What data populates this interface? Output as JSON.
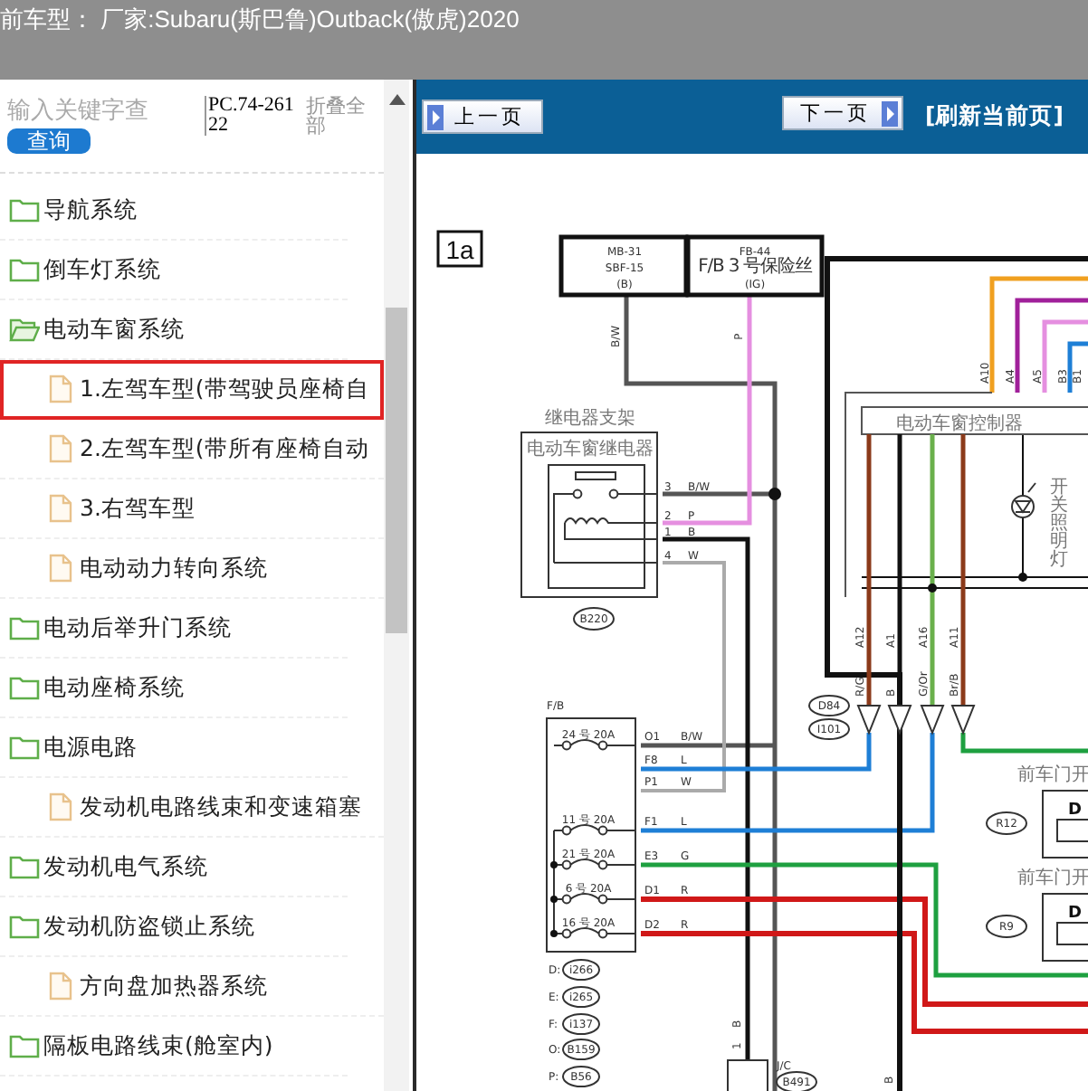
{
  "header": {
    "title": "前车型： 厂家:Subaru(斯巴鲁)Outback(傲虎)2020"
  },
  "sidebar": {
    "search": {
      "placeholder": "输入关键字查"
    },
    "search_button": "查询",
    "doc_code": "PC.74-26122",
    "collapse_all": "折叠全部",
    "tree": [
      {
        "kind": "folder",
        "label": "导航系统",
        "expanded": false
      },
      {
        "kind": "folder",
        "label": "倒车灯系统",
        "expanded": false
      },
      {
        "kind": "folder",
        "label": "电动车窗系统",
        "expanded": true,
        "children": [
          {
            "kind": "file",
            "label": "1.左驾车型(带驾驶员座椅自",
            "selected": true
          },
          {
            "kind": "file",
            "label": "2.左驾车型(带所有座椅自动",
            "selected": false
          },
          {
            "kind": "file",
            "label": "3.右驾车型",
            "selected": false
          }
        ]
      },
      {
        "kind": "file",
        "label": "电动动力转向系统",
        "selected": false
      },
      {
        "kind": "folder",
        "label": "电动后举升门系统",
        "expanded": false
      },
      {
        "kind": "folder",
        "label": "电动座椅系统",
        "expanded": false
      },
      {
        "kind": "folder",
        "label": "电源电路",
        "expanded": false
      },
      {
        "kind": "file",
        "label": "发动机电路线束和变速箱塞",
        "selected": false
      },
      {
        "kind": "folder",
        "label": "发动机电气系统",
        "expanded": false
      },
      {
        "kind": "folder",
        "label": "发动机防盗锁止系统",
        "expanded": false
      },
      {
        "kind": "file",
        "label": "方向盘加热器系统",
        "selected": false
      },
      {
        "kind": "folder",
        "label": "隔板电路线束(舱室内)",
        "expanded": false
      }
    ]
  },
  "toolbar": {
    "prev": "上一页",
    "next": "下一页",
    "refresh": "[刷新当前页]"
  },
  "diagram": {
    "page_label": "1a",
    "sources": [
      {
        "lines": [
          "MB-31",
          "SBF-15",
          "(B)"
        ]
      },
      {
        "lines": [
          "FB-44",
          "F/B 3 号保险丝",
          "(IG)"
        ]
      }
    ],
    "source_wires": [
      "B/W",
      "P"
    ],
    "relay": {
      "bracket": "继电器支架",
      "name": "电动车窗继电器",
      "connector": "B220",
      "pins": [
        {
          "no": "3",
          "wire": "B/W"
        },
        {
          "no": "2",
          "wire": "P"
        },
        {
          "no": "1",
          "wire": "B"
        },
        {
          "no": "4",
          "wire": "W"
        }
      ]
    },
    "controller": {
      "name": "电动车窗控制器",
      "lamp": "开关照明灯",
      "top_pins": [
        "A10",
        "A4",
        "A5",
        "B3",
        "B1"
      ],
      "bottom_pins": [
        {
          "pin": "A12",
          "wire": "R/G"
        },
        {
          "pin": "A1",
          "wire": "B"
        },
        {
          "pin": "A16",
          "wire": "G/Or"
        },
        {
          "pin": "A11",
          "wire": "Br/B"
        }
      ],
      "connectors": [
        "D84",
        "I101"
      ]
    },
    "fuse_box": {
      "name": "F/B",
      "rows": [
        {
          "fuse": "24 号 20A",
          "pin": "O1",
          "wire": "B/W"
        },
        {
          "pin": "F8",
          "wire": "L"
        },
        {
          "pin": "P1",
          "wire": "W"
        },
        {
          "fuse": "11 号 20A",
          "pin": "F1",
          "wire": "L"
        },
        {
          "fuse": "21 号 20A",
          "pin": "E3",
          "wire": "G"
        },
        {
          "fuse": "6 号 20A",
          "pin": "D1",
          "wire": "R"
        },
        {
          "fuse": "16 号 20A",
          "pin": "D2",
          "wire": "R"
        }
      ]
    },
    "legend": [
      {
        "letter": "D:",
        "connector": "i266"
      },
      {
        "letter": "E:",
        "connector": "i265"
      },
      {
        "letter": "F:",
        "connector": "i137"
      },
      {
        "letter": "O:",
        "connector": "B159"
      },
      {
        "letter": "P:",
        "connector": "B56"
      }
    ],
    "doors": [
      {
        "title": "前车门开",
        "connector": "R12",
        "pin": "D"
      },
      {
        "title": "前车门开",
        "connector": "R9",
        "pin": "D"
      }
    ],
    "junction": {
      "name": "J/C",
      "connector": "B491",
      "pin": "1",
      "wire": "B"
    },
    "ground_wire": "B"
  }
}
